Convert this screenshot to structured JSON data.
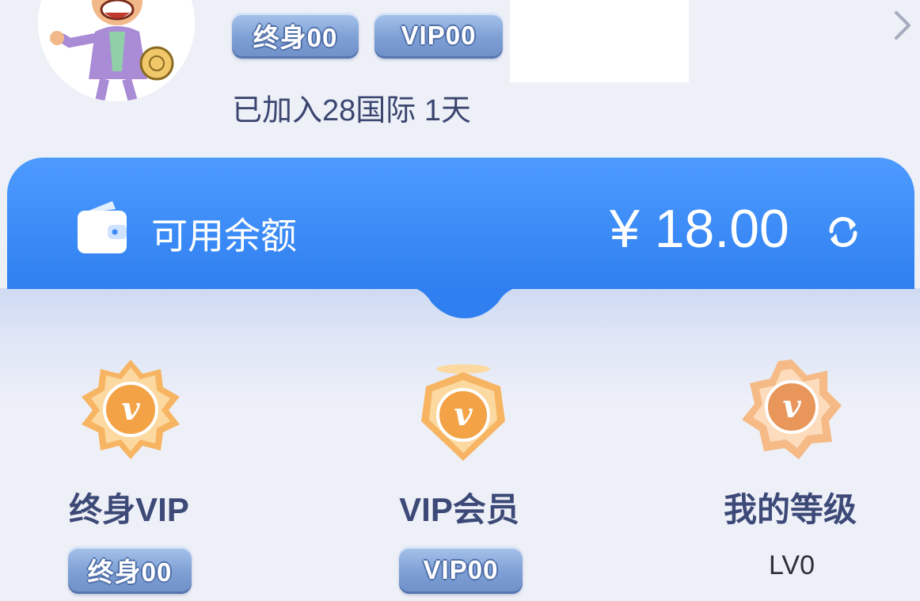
{
  "profile": {
    "badges": [
      "终身00",
      "VIP00"
    ],
    "joined_text": "已加入28国际 1天"
  },
  "balance": {
    "label": "可用余额",
    "amount": "¥ 18.00"
  },
  "features": [
    {
      "title": "终身VIP",
      "badge": "终身00"
    },
    {
      "title": "VIP会员",
      "badge": "VIP00"
    },
    {
      "title": "我的等级",
      "value": "LV0"
    }
  ],
  "icons": {
    "wallet": "wallet-icon",
    "refresh": "refresh-icon",
    "chevron": "chevron-right-icon",
    "medal": "vip-medal-icon"
  },
  "colors": {
    "card_blue": "#3a8af8",
    "badge_blue": "#7d9fd4",
    "medal_orange": "#f3a245",
    "title_text": "#3d4a78"
  }
}
